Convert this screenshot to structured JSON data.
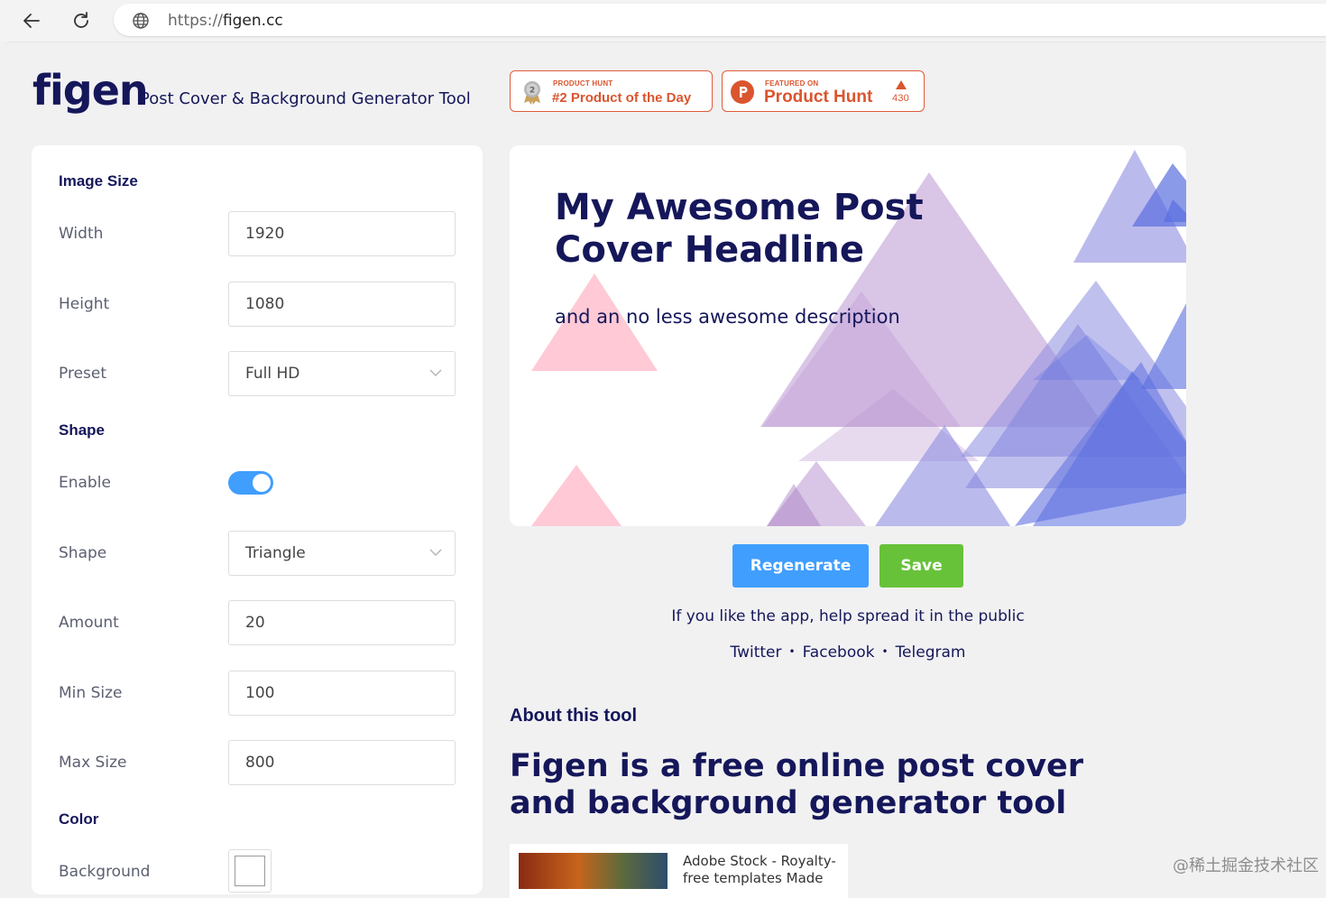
{
  "browser": {
    "url_prefix": "https://",
    "url_host": "figen.cc"
  },
  "header": {
    "logo": "figen",
    "tagline": "Post Cover & Background Generator Tool",
    "badges": [
      {
        "small": "PRODUCT HUNT",
        "big": "#2 Product of the Day"
      },
      {
        "small": "FEATURED ON",
        "big": "Product Hunt",
        "votes": "430"
      }
    ]
  },
  "settings": {
    "image_size": {
      "title": "Image Size",
      "width_label": "Width",
      "width_value": "1920",
      "height_label": "Height",
      "height_value": "1080",
      "preset_label": "Preset",
      "preset_value": "Full HD"
    },
    "shape": {
      "title": "Shape",
      "enable_label": "Enable",
      "enabled": true,
      "shape_label": "Shape",
      "shape_value": "Triangle",
      "amount_label": "Amount",
      "amount_value": "20",
      "min_label": "Min Size",
      "min_value": "100",
      "max_label": "Max Size",
      "max_value": "800"
    },
    "color": {
      "title": "Color",
      "background_label": "Background",
      "background_value": "#ffffff"
    }
  },
  "preview": {
    "headline": "My Awesome Post Cover Headline",
    "description": "and an no less awesome description"
  },
  "actions": {
    "regenerate": "Regenerate",
    "save": "Save"
  },
  "share": {
    "text": "If you like the app, help spread it in the public",
    "links": [
      "Twitter",
      "Facebook",
      "Telegram"
    ]
  },
  "about": {
    "heading": "About this tool",
    "title": "Figen is a free online post cover and background generator tool"
  },
  "ad": {
    "text": "Adobe Stock - Royalty-free templates Made"
  },
  "watermark": "@稀土掘金技术社区",
  "colors": {
    "brand": "#15175a",
    "accent_blue": "#409eff",
    "save_green": "#67c23a",
    "ph_orange": "#da552f"
  }
}
